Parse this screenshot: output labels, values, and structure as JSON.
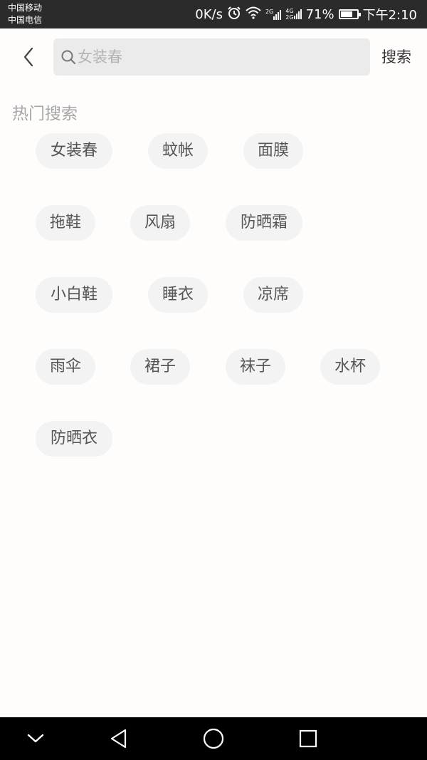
{
  "status_bar": {
    "carrier_1": "中国移动",
    "carrier_2": "中国电信",
    "speed": "0K/s",
    "sig1_label": "2G",
    "sig2_label_top": "4G",
    "sig2_label_bottom": "2G",
    "battery": "71%",
    "battery_level": 0.71,
    "time": "下午2:10"
  },
  "search": {
    "placeholder": "女装春",
    "button_label": "搜索"
  },
  "hot_search": {
    "title": "热门搜索",
    "tags": [
      "女装春",
      "蚊帐",
      "面膜",
      "拖鞋",
      "风扇",
      "防晒霜",
      "小白鞋",
      "睡衣",
      "凉席",
      "雨伞",
      "裙子",
      "袜子",
      "水杯",
      "防晒衣"
    ]
  },
  "icons": {
    "back": "chevron-left-icon",
    "search": "search-icon",
    "nav_down": "chevron-down-icon",
    "nav_back": "triangle-back-icon",
    "nav_home": "circle-home-icon",
    "nav_recent": "square-recent-icon"
  },
  "colors": {
    "status_bar": "#2b2b2b",
    "page_bg": "#fffcfc",
    "search_bg": "#ebebeb",
    "tag_bg": "#f3f3f3",
    "tag_text": "#555555",
    "section_title": "#a6a6a6",
    "nav_bar": "#000000"
  }
}
